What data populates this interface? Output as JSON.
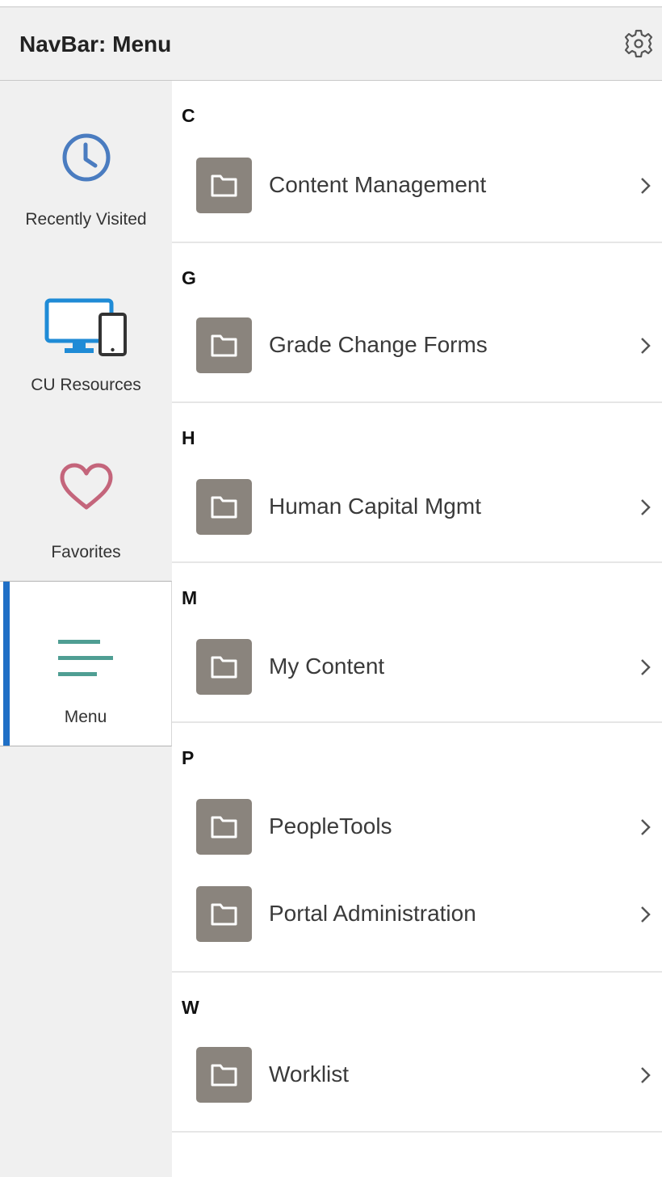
{
  "header": {
    "title": "NavBar: Menu",
    "settings_icon": "gear-icon"
  },
  "sidebar": {
    "items": [
      {
        "label": "Recently Visited",
        "icon": "clock-icon",
        "color": "#4a7cc0"
      },
      {
        "label": "CU Resources",
        "icon": "devices-icon",
        "color": "#1f8bd6"
      },
      {
        "label": "Favorites",
        "icon": "heart-icon",
        "color": "#c4657b"
      },
      {
        "label": "Menu",
        "icon": "menu-lines-icon",
        "color": "#4f9e93",
        "active": true
      }
    ]
  },
  "menu": {
    "groups": [
      {
        "letter": "C",
        "items": [
          {
            "label": "Content Management"
          }
        ]
      },
      {
        "letter": "G",
        "items": [
          {
            "label": "Grade Change Forms"
          }
        ]
      },
      {
        "letter": "H",
        "items": [
          {
            "label": "Human Capital Mgmt"
          }
        ]
      },
      {
        "letter": "M",
        "items": [
          {
            "label": "My Content"
          }
        ]
      },
      {
        "letter": "P",
        "items": [
          {
            "label": "PeopleTools"
          },
          {
            "label": "Portal Administration"
          }
        ]
      },
      {
        "letter": "W",
        "items": [
          {
            "label": "Worklist"
          }
        ]
      }
    ]
  },
  "colors": {
    "active_accent": "#1f6fc6",
    "folder_tile": "#8a847d"
  }
}
